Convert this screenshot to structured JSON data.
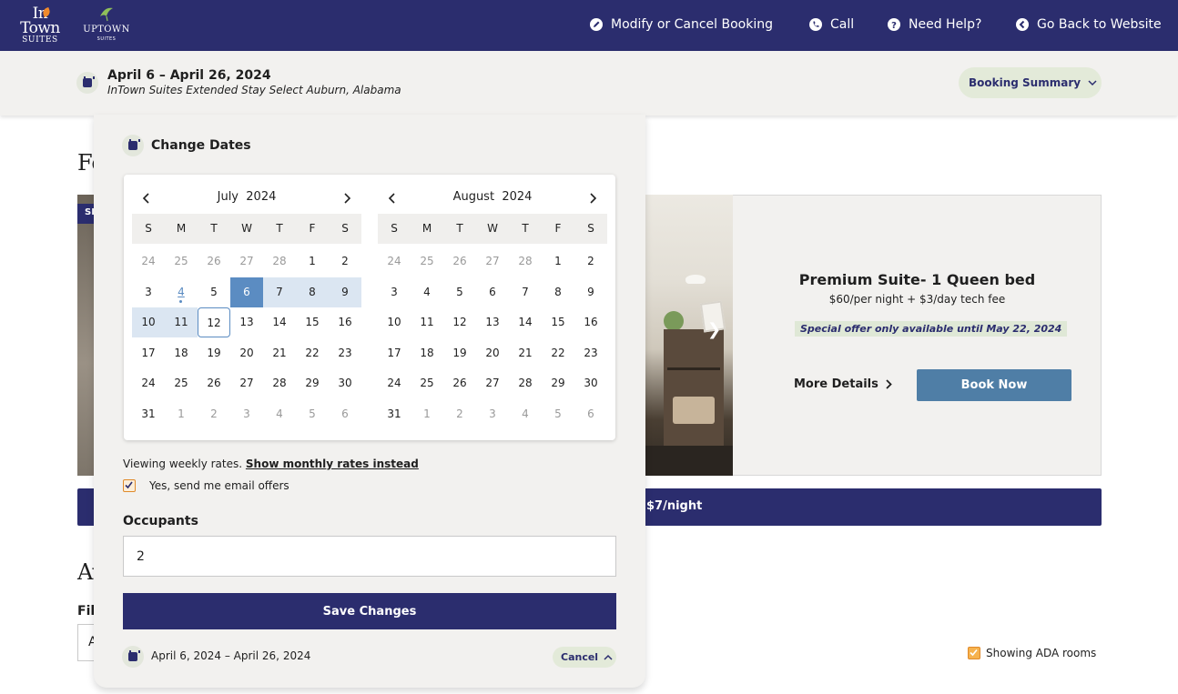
{
  "nav": {
    "logo_intown_line1": "In",
    "logo_intown_line2": "Town",
    "logo_intown_line3": "SUITES",
    "logo_uptown_line1": "UPTOWN",
    "logo_uptown_line2": "SUITES",
    "items": [
      {
        "label": "Modify or Cancel Booking",
        "icon": "edit-icon"
      },
      {
        "label": "Call",
        "icon": "phone-icon"
      },
      {
        "label": "Need Help?",
        "icon": "help-icon"
      },
      {
        "label": "Go Back to Website",
        "icon": "back-arrow-icon"
      }
    ]
  },
  "summary": {
    "dates": "April 6 – April 26, 2024",
    "hotel": "InTown Suites Extended Stay Select Auburn, Alabama",
    "booking_summary_label": "Booking Summary"
  },
  "background": {
    "title_partial": "Fo",
    "badge_partial": "SI",
    "room_name": "Premium Suite- 1 Queen bed",
    "room_price": "$60/per night + $3/day tech fee",
    "room_offer": "Special offer only available until May 22, 2024",
    "more_details": "More Details",
    "book_now": "Book Now",
    "rate_bar_text": "$7/night",
    "title2_partial": "Av",
    "filter_label_partial": "Fil",
    "filter_value_partial": "A",
    "ada_label": "Showing ADA rooms"
  },
  "panel": {
    "title": "Change Dates",
    "weekday_headers": [
      "S",
      "M",
      "T",
      "W",
      "T",
      "F",
      "S"
    ],
    "months": [
      {
        "name": "July",
        "year": "2024",
        "days": [
          [
            "24",
            "25",
            "26",
            "27",
            "28",
            "1",
            "2"
          ],
          [
            "3",
            "4",
            "5",
            "6",
            "7",
            "8",
            "9"
          ],
          [
            "10",
            "11",
            "12",
            "13",
            "14",
            "15",
            "16"
          ],
          [
            "17",
            "18",
            "19",
            "20",
            "21",
            "22",
            "23"
          ],
          [
            "24",
            "25",
            "26",
            "27",
            "28",
            "29",
            "30"
          ],
          [
            "31",
            "1",
            "2",
            "3",
            "4",
            "5",
            "6"
          ]
        ]
      },
      {
        "name": "August",
        "year": "2024",
        "days": [
          [
            "24",
            "25",
            "26",
            "27",
            "28",
            "1",
            "2"
          ],
          [
            "3",
            "4",
            "5",
            "6",
            "7",
            "8",
            "9"
          ],
          [
            "10",
            "11",
            "12",
            "13",
            "14",
            "15",
            "16"
          ],
          [
            "17",
            "18",
            "19",
            "20",
            "21",
            "22",
            "23"
          ],
          [
            "24",
            "25",
            "26",
            "27",
            "28",
            "29",
            "30"
          ],
          [
            "31",
            "1",
            "2",
            "3",
            "4",
            "5",
            "6"
          ]
        ]
      }
    ],
    "weekly_text": "Viewing weekly rates.",
    "monthly_link": "Show monthly rates instead",
    "email_offers_label": "Yes, send me email offers",
    "email_offers_checked": true,
    "occupants_label": "Occupants",
    "occupants_value": "2",
    "save_label": "Save Changes",
    "footer_dates": "April 6, 2024 – April 26, 2024",
    "cancel_label": "Cancel"
  },
  "colors": {
    "brand_navy": "#2b2d6e",
    "accent_blue": "#5b8cc2",
    "range_blue": "#dbe6f2",
    "pill_green": "#e3ead9",
    "checkbox_orange": "#f6b24e"
  }
}
